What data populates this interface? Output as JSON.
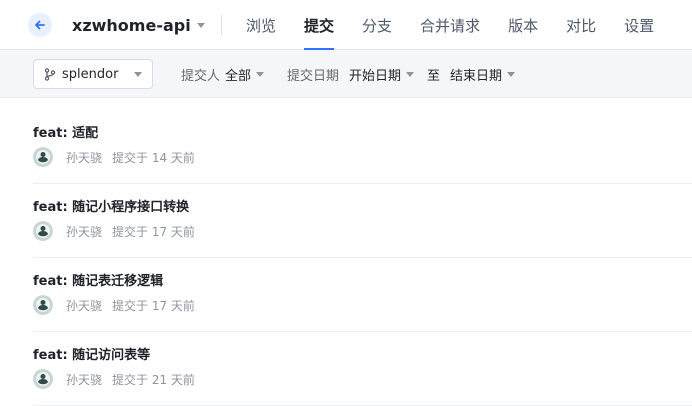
{
  "header": {
    "repo_name": "xzwhome-api",
    "tabs": [
      {
        "label": "浏览"
      },
      {
        "label": "提交"
      },
      {
        "label": "分支"
      },
      {
        "label": "合并请求"
      },
      {
        "label": "版本"
      },
      {
        "label": "对比"
      },
      {
        "label": "设置"
      }
    ],
    "active_tab": "提交"
  },
  "filters": {
    "branch": "splendor",
    "committer_label": "提交人",
    "committer_value": "全部",
    "date_label": "提交日期",
    "start_date": "开始日期",
    "to_label": "至",
    "end_date": "结束日期"
  },
  "commits": [
    {
      "title": "feat: 适配",
      "author": "孙天骁",
      "time": "提交于 14 天前"
    },
    {
      "title": "feat: 随记小程序接口转换",
      "author": "孙天骁",
      "time": "提交于 17 天前"
    },
    {
      "title": "feat: 随记表迁移逻辑",
      "author": "孙天骁",
      "time": "提交于 17 天前"
    },
    {
      "title": "feat: 随记访问表等",
      "author": "孙天骁",
      "time": "提交于 21 天前"
    }
  ],
  "colors": {
    "accent": "#3370ff"
  }
}
